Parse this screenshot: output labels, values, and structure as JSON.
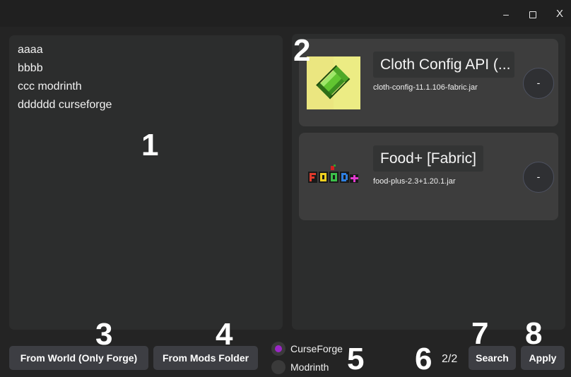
{
  "window": {
    "controls": {
      "minimize": "–",
      "maximize": "",
      "close": "X"
    }
  },
  "textbox": {
    "value": "aaaa\nbbbb\nccc modrinth\ndddddd curseforge"
  },
  "mods": [
    {
      "title": "Cloth Config API (...",
      "file": "cloth-config-11.1.106-fabric.jar",
      "remove_label": "-",
      "icon": "cloth-config-icon"
    },
    {
      "title": "Food+ [Fabric]",
      "file": "food-plus-2.3+1.20.1.jar",
      "remove_label": "-",
      "icon": "food-plus-logo"
    }
  ],
  "buttons": {
    "from_world": "From World (Only Forge)",
    "from_mods_folder": "From Mods Folder",
    "search": "Search",
    "apply": "Apply"
  },
  "source": {
    "options": [
      "CurseForge",
      "Modrinth"
    ],
    "selected": "CurseForge"
  },
  "pager": "2/2",
  "annotations": [
    "1",
    "2",
    "3",
    "4",
    "5",
    "6",
    "7",
    "8"
  ],
  "colors": {
    "background": "#242424",
    "panel": "#2c2d2d",
    "card": "#3d3d3d",
    "button": "#3d3e43",
    "radio_selected": "#9b27c7"
  }
}
